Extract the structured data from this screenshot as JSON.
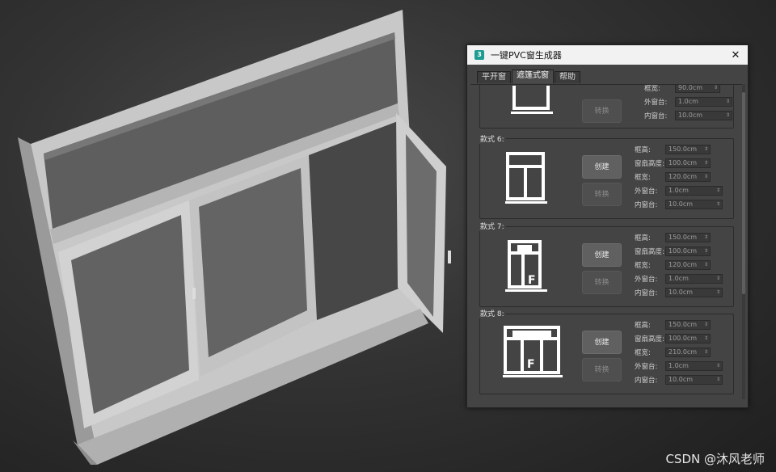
{
  "dialog": {
    "title": "一键PVC窗生成器",
    "app_icon_text": "3",
    "close_glyph": "✕",
    "tabs": [
      "平开窗",
      "遮篷式窗",
      "帮助"
    ],
    "active_tab": 1
  },
  "partial_top": {
    "rows": [
      {
        "label": "框宽:",
        "value": "90.0cm"
      },
      {
        "label": "外窗台:",
        "value": "1.0cm"
      },
      {
        "label": "内窗台:",
        "value": "10.0cm"
      }
    ],
    "convert_label": "转换"
  },
  "styles": [
    {
      "title": "款式 6:",
      "create_label": "创建",
      "convert_label": "转换",
      "icon": "window-style-6-icon",
      "rows": [
        {
          "label": "框高:",
          "value": "150.0cm"
        },
        {
          "label": "窗扇高度:",
          "value": "100.0cm"
        },
        {
          "label": "框宽:",
          "value": "120.0cm"
        },
        {
          "label": "外窗台:",
          "value": "1.0cm"
        },
        {
          "label": "内窗台:",
          "value": "10.0cm"
        }
      ]
    },
    {
      "title": "款式 7:",
      "create_label": "创建",
      "convert_label": "转换",
      "icon": "window-style-7-icon",
      "rows": [
        {
          "label": "框高:",
          "value": "150.0cm"
        },
        {
          "label": "窗扇高度:",
          "value": "100.0cm"
        },
        {
          "label": "框宽:",
          "value": "120.0cm"
        },
        {
          "label": "外窗台:",
          "value": "1.0cm"
        },
        {
          "label": "内窗台:",
          "value": "10.0cm"
        }
      ]
    },
    {
      "title": "款式 8:",
      "create_label": "创建",
      "convert_label": "转换",
      "icon": "window-style-8-icon",
      "rows": [
        {
          "label": "框高:",
          "value": "150.0cm"
        },
        {
          "label": "窗扇高度:",
          "value": "100.0cm"
        },
        {
          "label": "框宽:",
          "value": "210.0cm"
        },
        {
          "label": "外窗台:",
          "value": "1.0cm"
        },
        {
          "label": "内窗台:",
          "value": "10.0cm"
        }
      ]
    }
  ],
  "fixed_pane_letter": "F",
  "watermark": "CSDN @沐风老师"
}
